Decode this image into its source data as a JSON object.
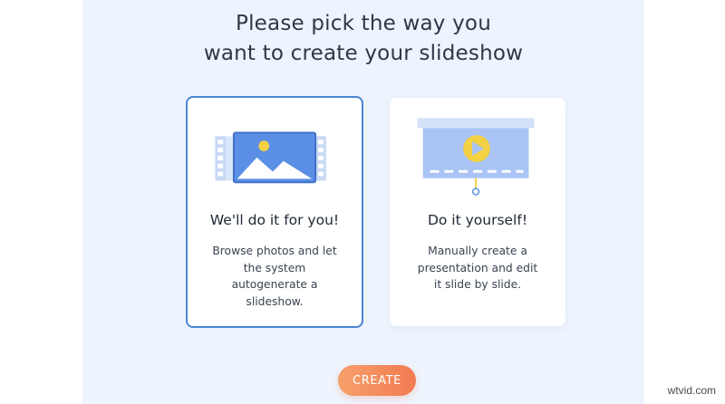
{
  "heading": {
    "line1": "Please pick the way you",
    "line2": "want to create your slideshow"
  },
  "options": [
    {
      "title": "We'll do it for you!",
      "desc_lines": [
        "Browse photos and let",
        "the system",
        "autogenerate a",
        "slideshow."
      ],
      "icon": "photo-filmstrip-icon",
      "selected": true
    },
    {
      "title": "Do it yourself!",
      "desc_lines": [
        "Manually create a",
        "presentation and edit",
        "it slide by slide."
      ],
      "icon": "video-presentation-screen-icon",
      "selected": false
    }
  ],
  "create_label": "CREATE",
  "watermark": "wtvid.com",
  "colors": {
    "panel_bg": "#eef4fd",
    "selected_border": "#4a86d0",
    "button_gradient_start": "#f6a06a",
    "button_gradient_end": "#f37a52",
    "icon_blue": "#5b8fe6",
    "icon_yellow": "#f3d143"
  }
}
